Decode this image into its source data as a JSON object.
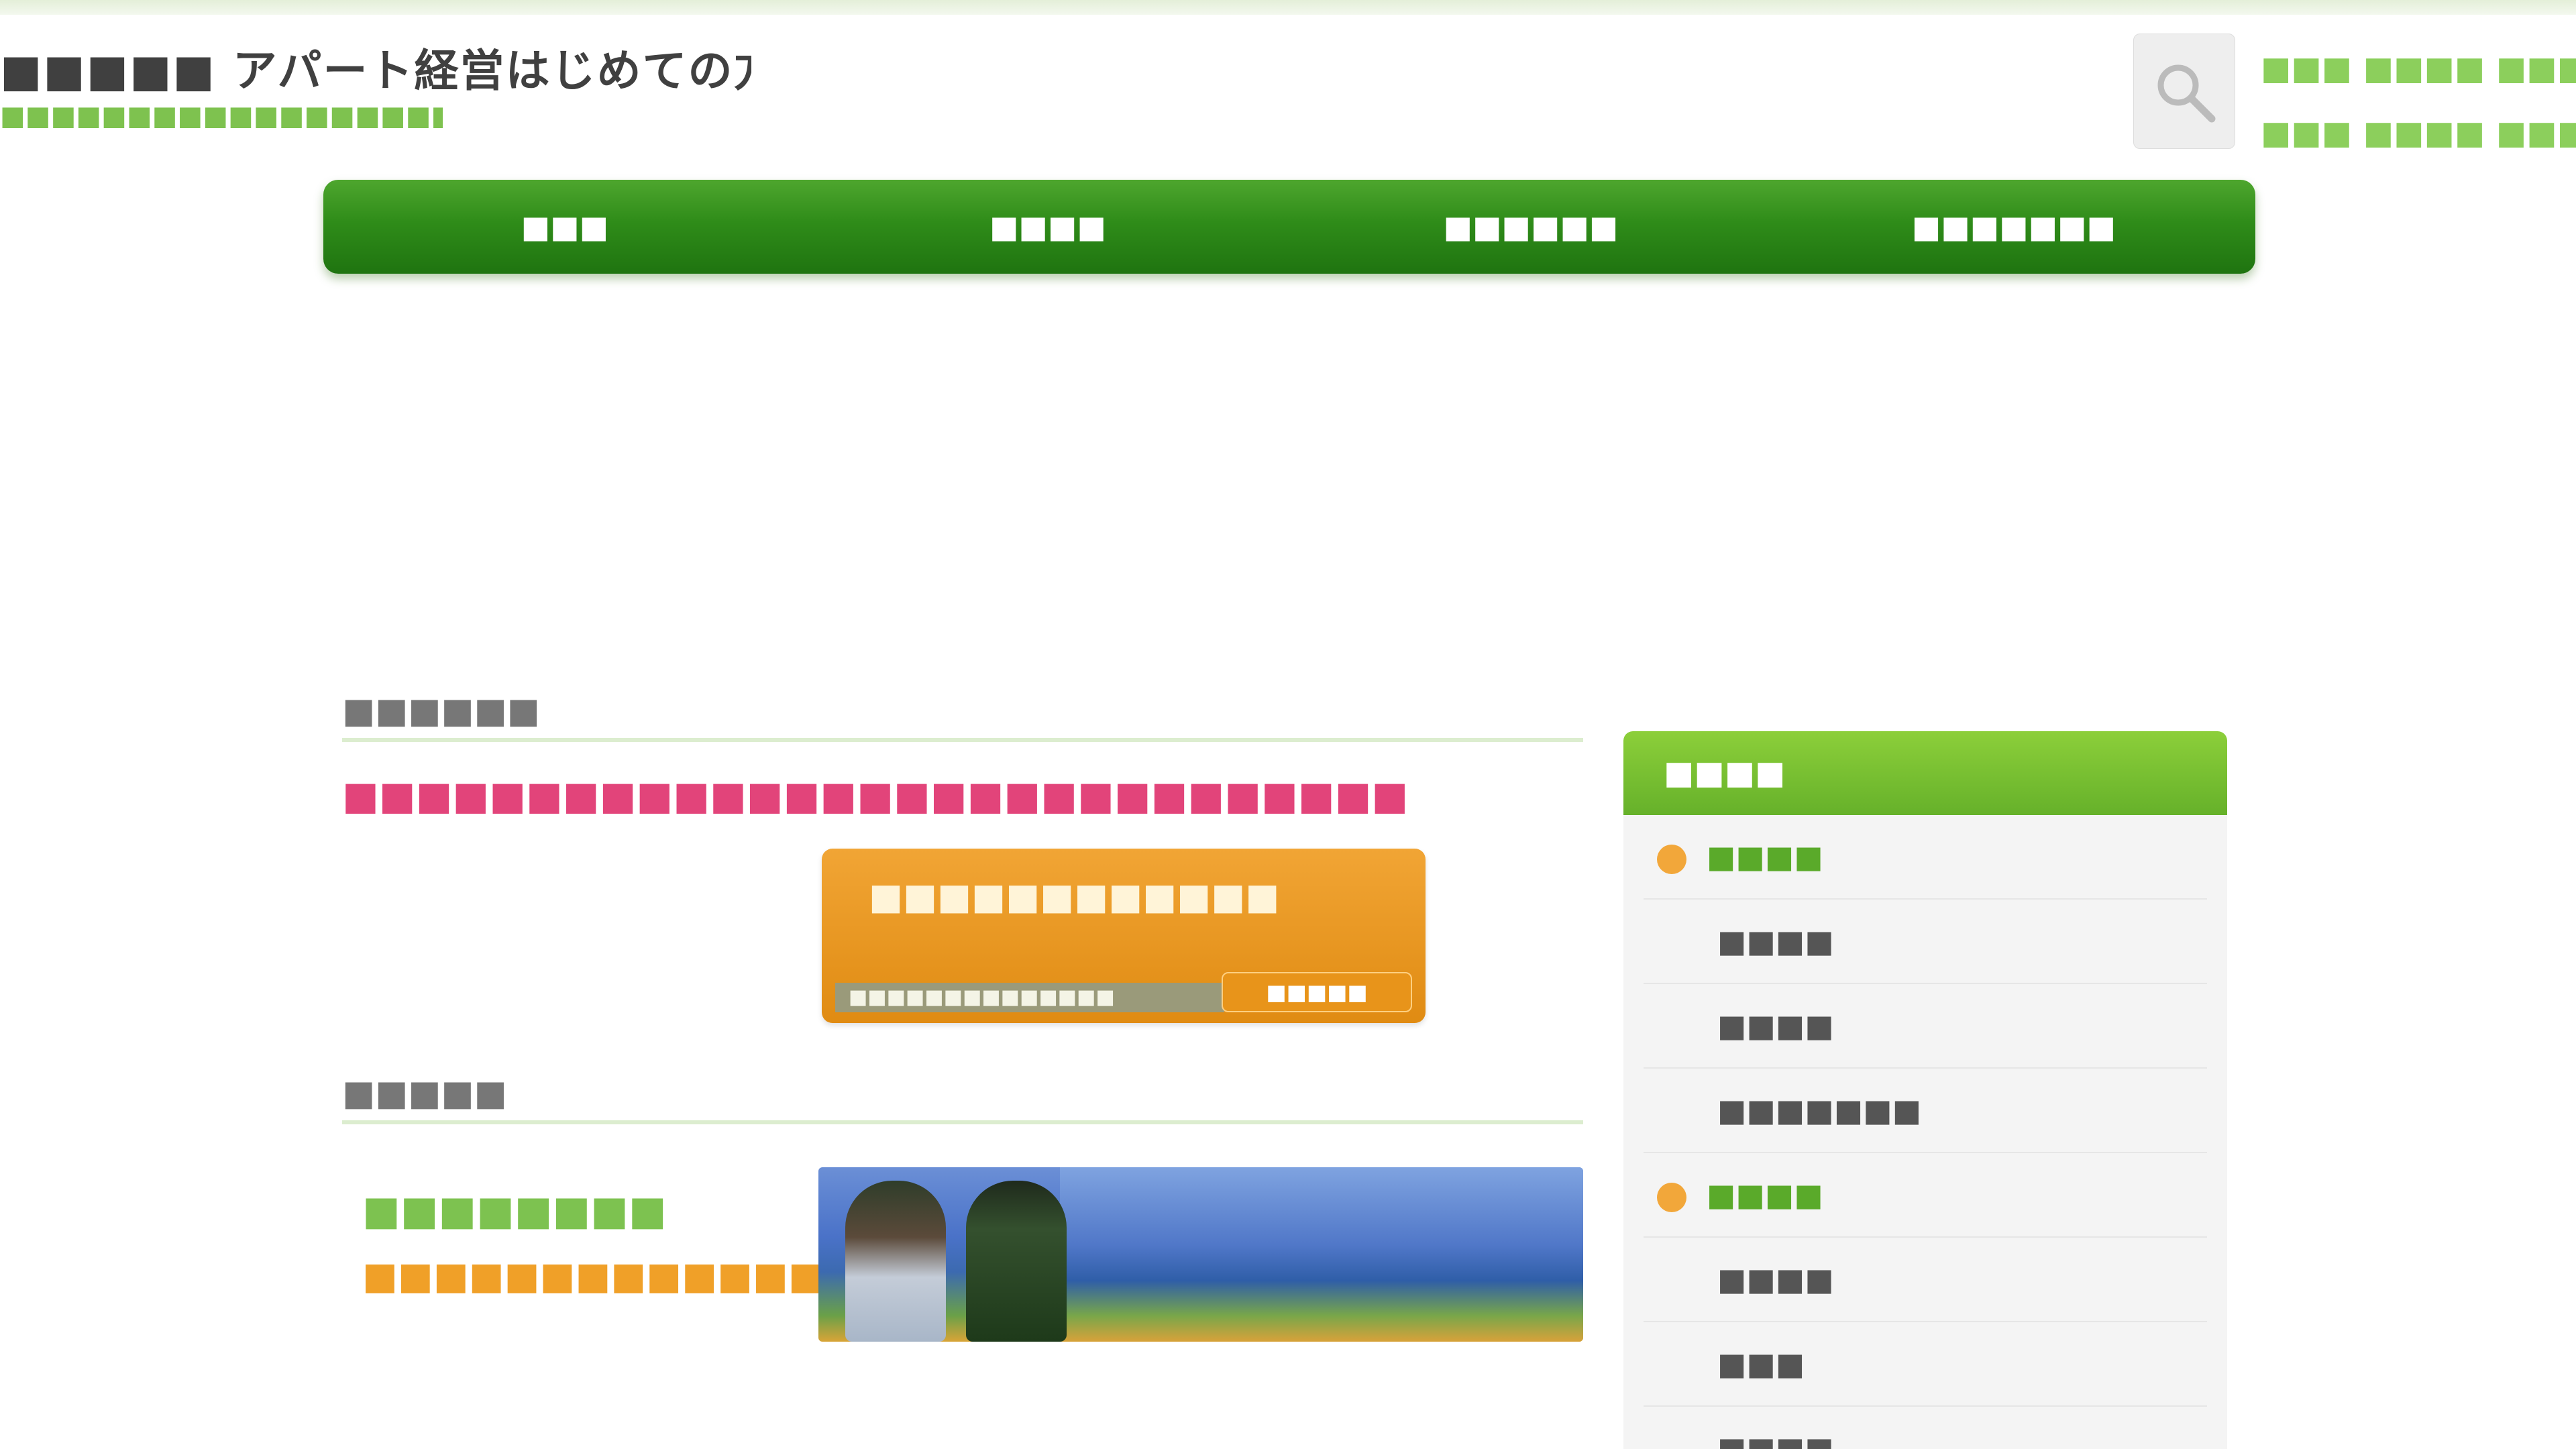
{
  "header": {
    "site_title": "■■■■■ アパート経営はじめての方のための基本",
    "site_subtitle": "■■■■■■■■■■■■■■■■■■",
    "search_label": "検索",
    "contact": [
      "■■■ ■■■■ ■■■",
      "■■■ ■■■■ ■■■"
    ]
  },
  "nav": {
    "items": [
      "■■■",
      "■■■■",
      "■■■■■■",
      "■■■■■■■"
    ]
  },
  "main": {
    "section1_title": "■■■■■■",
    "feature_link": "■■■■■■■■■■■■■■■■■■■■■■■■■■■■■",
    "banner": {
      "text": "■■■■■■■■■■■■",
      "subtext": "■■■■■■■■■■■■■■",
      "button": "■■■■■"
    },
    "section2_title": "■■■■■",
    "promo": {
      "line1": "■■■■■■■■",
      "line2": "■■■■■■■■■■■■■■"
    }
  },
  "sidebar": {
    "header": "■■■■",
    "items": [
      {
        "label": "■■■■",
        "type": "cat"
      },
      {
        "label": "■■■■",
        "type": "sub"
      },
      {
        "label": "■■■■",
        "type": "sub"
      },
      {
        "label": "■■■■■■■",
        "type": "sub"
      },
      {
        "label": "■■■■",
        "type": "cat"
      },
      {
        "label": "■■■■",
        "type": "sub"
      },
      {
        "label": "■■■",
        "type": "sub"
      },
      {
        "label": "■■■■",
        "type": "sub"
      }
    ]
  },
  "colors": {
    "nav_green": "#2f8c19",
    "sidebar_green": "#7cc23a",
    "accent_pink": "#e2447a",
    "accent_orange": "#f0a028",
    "bullet_orange": "#f2a73a"
  }
}
